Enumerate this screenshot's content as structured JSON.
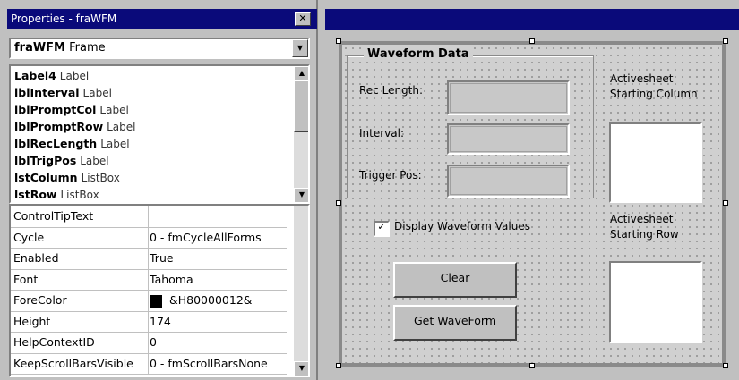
{
  "properties_window": {
    "title": "Properties - fraWFM",
    "close_glyph": "✕",
    "object_combo": {
      "name": "fraWFM",
      "type": "Frame"
    },
    "controls": [
      {
        "name": "Label4",
        "type": "Label"
      },
      {
        "name": "lblInterval",
        "type": "Label"
      },
      {
        "name": "lblPromptCol",
        "type": "Label"
      },
      {
        "name": "lblPromptRow",
        "type": "Label"
      },
      {
        "name": "lblRecLength",
        "type": "Label"
      },
      {
        "name": "lblTrigPos",
        "type": "Label"
      },
      {
        "name": "lstColumn",
        "type": "ListBox"
      },
      {
        "name": "lstRow",
        "type": "ListBox"
      }
    ],
    "properties": [
      {
        "name": "ControlTipText",
        "value": ""
      },
      {
        "name": "Cycle",
        "value": "0 - fmCycleAllForms"
      },
      {
        "name": "Enabled",
        "value": "True"
      },
      {
        "name": "Font",
        "value": "Tahoma"
      },
      {
        "name": "ForeColor",
        "value": "&H80000012&"
      },
      {
        "name": "Height",
        "value": "174"
      },
      {
        "name": "HelpContextID",
        "value": "0"
      },
      {
        "name": "KeepScrollBarsVisible",
        "value": "0 - fmScrollBarsNone"
      }
    ],
    "forecolor_swatch": "#000000"
  },
  "designer": {
    "group_title": "Waveform Data",
    "rec_length_label": "Rec Length:",
    "interval_label": "Interval:",
    "trigger_pos_label": "Trigger Pos:",
    "starting_column_label": "Activesheet Starting Column",
    "starting_row_label": "Activesheet Starting Row",
    "display_checkbox_label": "Display Waveform Values",
    "display_checked": true,
    "check_glyph": "✓",
    "clear_button": "Clear",
    "get_waveform_button": "Get WaveForm"
  },
  "colors": {
    "titlebar": "#0a0a7a",
    "face": "#c0c0c0"
  }
}
